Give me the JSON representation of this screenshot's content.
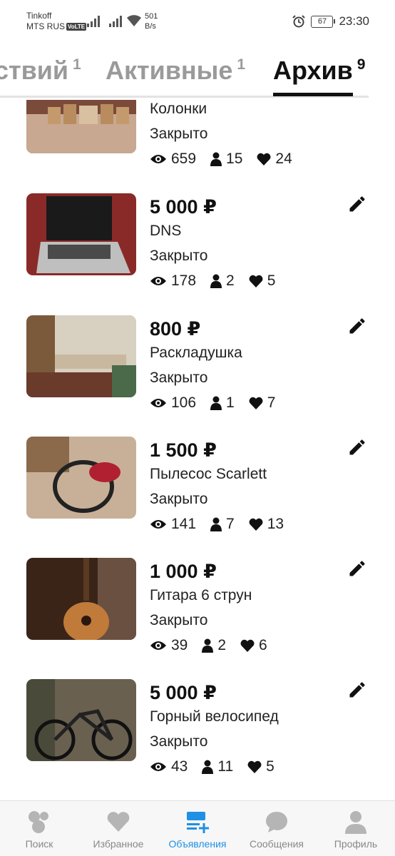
{
  "status_bar": {
    "carrier_1": "Tinkoff",
    "carrier_2": "MTS RUS",
    "volte": "VoLTE",
    "speed_value": "501",
    "speed_unit": "B/s",
    "battery": "67",
    "time": "23:30"
  },
  "tabs": [
    {
      "label": "ствий",
      "count": "1",
      "active": false
    },
    {
      "label": "Активные",
      "count": "1",
      "active": false
    },
    {
      "label": "Архив",
      "count": "9",
      "active": true
    }
  ],
  "items": [
    {
      "price": "",
      "title": "Колонки",
      "status": "Закрыто",
      "views": "659",
      "contacts": "15",
      "likes": "24",
      "photo": "speakers-photo"
    },
    {
      "price": "5 000 ₽",
      "title": "DNS",
      "status": "Закрыто",
      "views": "178",
      "contacts": "2",
      "likes": "5",
      "photo": "laptop-photo"
    },
    {
      "price": "800 ₽",
      "title": "Раскладушка",
      "status": "Закрыто",
      "views": "106",
      "contacts": "1",
      "likes": "7",
      "photo": "folding-bed-photo"
    },
    {
      "price": "1 500 ₽",
      "title": "Пылесос Scarlett",
      "status": "Закрыто",
      "views": "141",
      "contacts": "7",
      "likes": "13",
      "photo": "vacuum-photo"
    },
    {
      "price": "1 000 ₽",
      "title": "Гитара 6 струн",
      "status": "Закрыто",
      "views": "39",
      "contacts": "2",
      "likes": "6",
      "photo": "guitar-photo"
    },
    {
      "price": "5 000 ₽",
      "title": "Горный велосипед",
      "status": "Закрыто",
      "views": "43",
      "contacts": "11",
      "likes": "5",
      "photo": "bicycle-photo"
    }
  ],
  "bottom_nav": [
    {
      "label": "Поиск",
      "icon": "search-bubbles-icon",
      "active": false
    },
    {
      "label": "Избранное",
      "icon": "heart-icon",
      "active": false
    },
    {
      "label": "Объявления",
      "icon": "ads-list-add-icon",
      "active": true
    },
    {
      "label": "Сообщения",
      "icon": "chat-icon",
      "active": false
    },
    {
      "label": "Профиль",
      "icon": "profile-icon",
      "active": false
    }
  ],
  "colors": {
    "accent": "#1e90e6",
    "inactive": "#9a9a9a",
    "text": "#1a1a1a"
  }
}
